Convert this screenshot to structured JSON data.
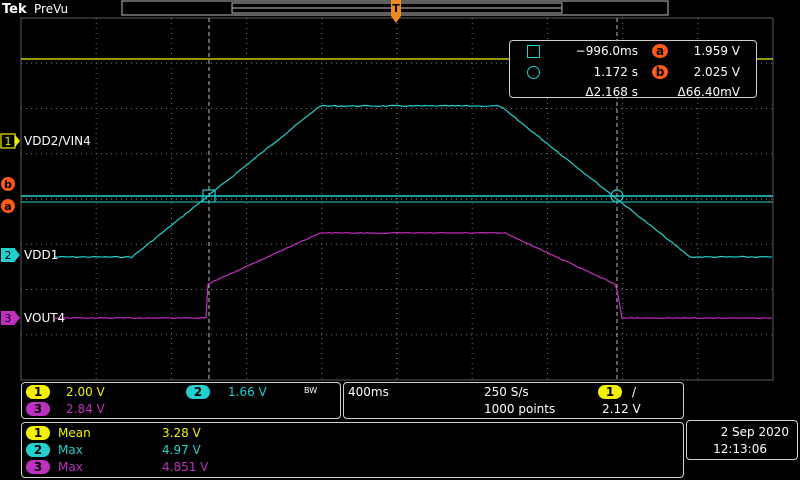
{
  "header": {
    "brand": "Tek",
    "mode": "PreVu",
    "trigger_marker": "T"
  },
  "channels": {
    "ch1": {
      "number": "1",
      "label": "VDD2/VIN4",
      "scale": "2.00 V",
      "color": "#f4f000"
    },
    "ch2": {
      "number": "2",
      "label": "VDD1",
      "scale": "1.66 V",
      "bw": "BW",
      "color": "#22d0d0"
    },
    "ch3": {
      "number": "3",
      "label": "VOUT4",
      "scale": "2.84 V",
      "color": "#c030c0"
    }
  },
  "cursors": {
    "a_label": "a",
    "b_label": "b",
    "row1": {
      "time": "−996.0ms",
      "value": "1.959 V"
    },
    "row2": {
      "time": "1.172 s",
      "value": "2.025 V"
    },
    "delta": {
      "time": "Δ2.168 s",
      "value": "Δ66.40mV"
    },
    "accent": "#ff5a1a"
  },
  "horizontal": {
    "timebase": "400ms",
    "sample_rate": "250 S/s",
    "record_length": "1000 points",
    "trigger_ch": "1",
    "trigger_slope": "/",
    "trigger_level": "2.12 V"
  },
  "measurements": [
    {
      "ch": "1",
      "type": "Mean",
      "value": "3.28 V",
      "color": "#f4f000"
    },
    {
      "ch": "2",
      "type": "Max",
      "value": "4.97 V",
      "color": "#22d0d0"
    },
    {
      "ch": "3",
      "type": "Max",
      "value": "4.851 V",
      "color": "#c030c0"
    }
  ],
  "datetime": {
    "date": "2 Sep  2020",
    "time": "12:13:06"
  }
}
